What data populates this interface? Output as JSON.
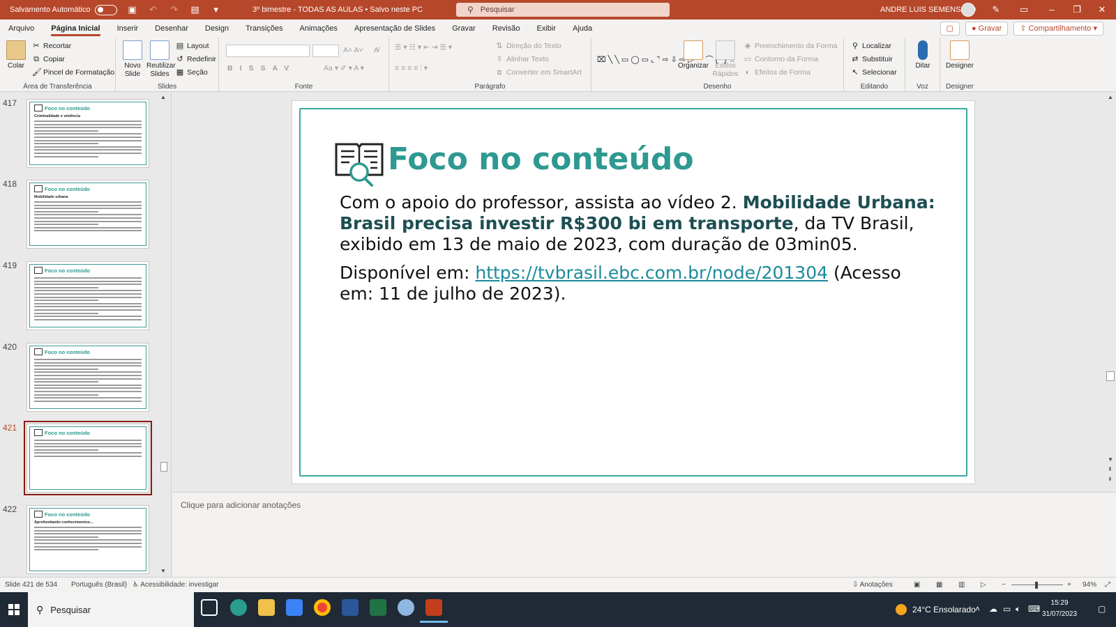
{
  "window": {
    "autosave_label": "Salvamento Automático",
    "doc_title": "3º bimestre - TODAS AS AULAS • Salvo neste PC",
    "search_placeholder": "Pesquisar",
    "user_name": "ANDRE LUIS SEMENSATO"
  },
  "tabs": [
    "Arquivo",
    "Página Inicial",
    "Inserir",
    "Desenhar",
    "Design",
    "Transições",
    "Animações",
    "Apresentação de Slides",
    "Gravar",
    "Revisão",
    "Exibir",
    "Ajuda"
  ],
  "tabs_right": {
    "record": "Gravar",
    "share": "Compartilhamento"
  },
  "ribbon": {
    "clipboard": {
      "label": "Área de Transferência",
      "paste": "Colar",
      "cut": "Recortar",
      "copy": "Copiar",
      "format_painter": "Pincel de Formatação"
    },
    "slides": {
      "label": "Slides",
      "new_slide": "Novo Slide",
      "reuse": "Reutilizar Slides",
      "layout": "Layout",
      "reset": "Redefinir",
      "section": "Seção"
    },
    "font": {
      "label": "Fonte"
    },
    "paragraph": {
      "label": "Parágrafo",
      "text_direction": "Direção do Texto",
      "align_text": "Alinhar Texto",
      "smartart": "Converter em SmartArt"
    },
    "drawing": {
      "label": "Desenho",
      "arrange": "Organizar",
      "quick_styles": "Estilos Rápidos",
      "shape_fill": "Preenchimento da Forma",
      "shape_outline": "Contorno da Forma",
      "shape_effects": "Efeitos de Forma"
    },
    "editing": {
      "label": "Editando",
      "find": "Localizar",
      "replace": "Substituir",
      "select": "Selecionar"
    },
    "voice": {
      "label": "Voz",
      "dictate": "Ditar"
    },
    "designer": {
      "label": "Designer",
      "designer": "Designer"
    }
  },
  "thumbnails": [
    {
      "num": "417",
      "title": "Foco no conteúdo",
      "subtitle": "Criminalidade e violência",
      "lines": 12
    },
    {
      "num": "418",
      "title": "Foco no conteúdo",
      "subtitle": "Mobilidade urbana",
      "lines": 10
    },
    {
      "num": "419",
      "title": "Foco no conteúdo",
      "subtitle": "",
      "lines": 14
    },
    {
      "num": "420",
      "title": "Foco no conteúdo",
      "subtitle": "",
      "lines": 14
    },
    {
      "num": "421",
      "title": "Foco no conteúdo",
      "subtitle": "",
      "lines": 6
    },
    {
      "num": "422",
      "title": "Foco no conteúdo",
      "subtitle": "Aprofundando conhecimentos...",
      "lines": 8
    }
  ],
  "slide": {
    "title": "Foco no conteúdo",
    "p1_a": "Com o apoio do professor, assista ao vídeo 2. ",
    "p1_bold": "Mobilidade Urbana: Brasil precisa investir R$300 bi em transporte",
    "p1_b": ", da TV Brasil, exibido em 13 de maio de 2023, com duração de 03min05.",
    "p2_a": "Disponível em: ",
    "p2_link": "https://tvbrasil.ebc.com.br/node/201304",
    "p2_b": " (Acesso em: 11 de julho de 2023)."
  },
  "notes_placeholder": "Clique para adicionar anotações",
  "status": {
    "slide_count": "Slide 421 de 534",
    "language": "Português (Brasil)",
    "accessibility": "Acessibilidade: investigar",
    "notes": "Anotações",
    "zoom": "94%"
  },
  "taskbar": {
    "search": "Pesquisar",
    "weather": "24°C  Ensolarado",
    "time": "15:29",
    "date": "31/07/2023"
  },
  "colors": {
    "accent": "#b7472a",
    "slide_teal": "#2e9990",
    "link": "#1a8b9b"
  }
}
